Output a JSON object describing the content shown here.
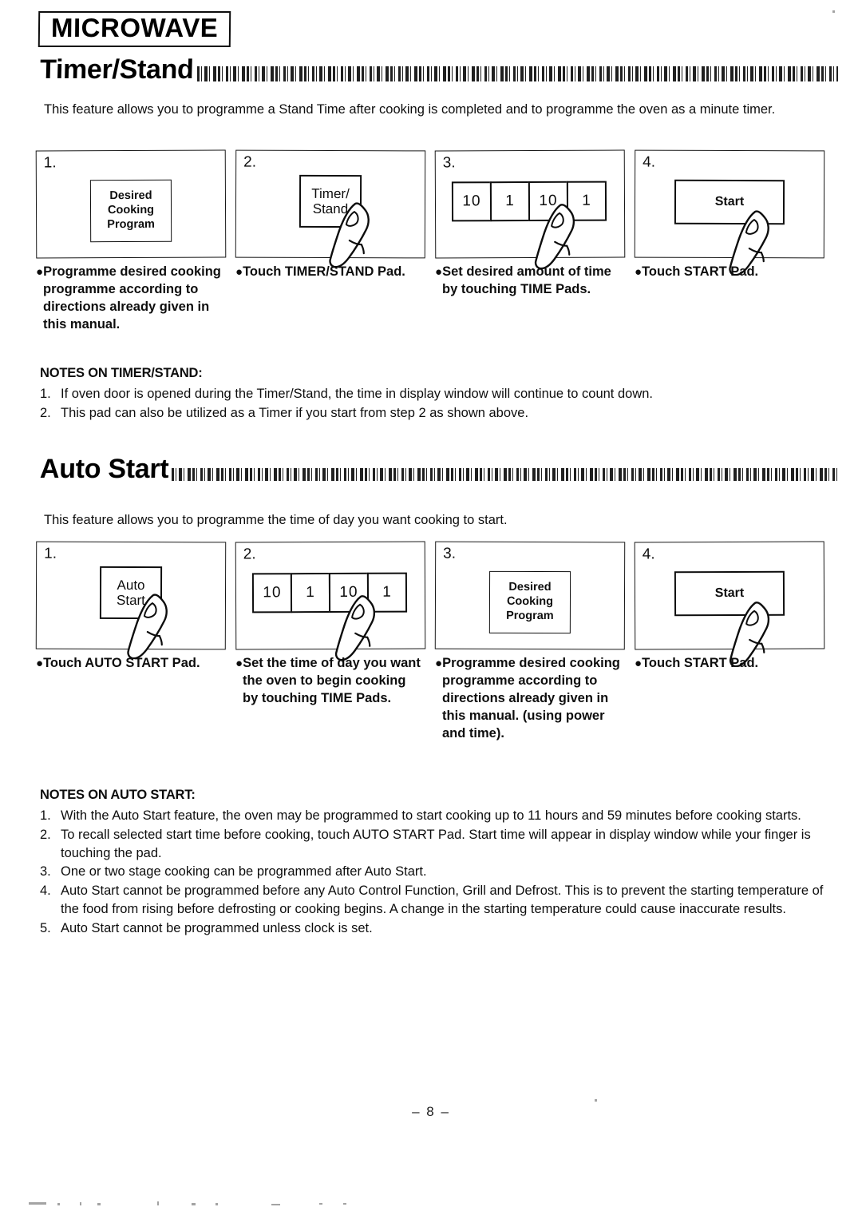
{
  "header": {
    "badge": "MICROWAVE"
  },
  "sections": [
    {
      "title": "Timer/Stand",
      "intro": "This feature allows you to programme a Stand Time after cooking is completed and to programme the oven as a minute timer.",
      "steps": [
        {
          "number": "1.",
          "pad_type": "program",
          "pad_lines": [
            "Desired",
            "Cooking",
            "Program"
          ],
          "finger": false,
          "caption": "Programme desired cooking programme according to directions already given in this manual."
        },
        {
          "number": "2.",
          "pad_type": "square",
          "pad_lines": [
            "Timer/",
            "Stand"
          ],
          "finger": true,
          "caption": "Touch TIMER/STAND Pad."
        },
        {
          "number": "3.",
          "pad_type": "keys",
          "keys": [
            "10",
            "1",
            "10",
            "1"
          ],
          "finger": true,
          "caption": "Set desired amount of time by touching TIME Pads."
        },
        {
          "number": "4.",
          "pad_type": "start",
          "pad_lines": [
            "Start"
          ],
          "finger": true,
          "caption": "Touch START Pad."
        }
      ],
      "notes_title": "NOTES ON TIMER/STAND:",
      "notes": [
        {
          "num": "1.",
          "text": "If oven door is opened during the Timer/Stand, the time in display window will continue to count down."
        },
        {
          "num": "2.",
          "text": "This pad can also be utilized as a Timer if you start from step 2 as shown above."
        }
      ]
    },
    {
      "title": "Auto Start",
      "intro": "This feature allows you to programme the time of day you want cooking to start.",
      "steps": [
        {
          "number": "1.",
          "pad_type": "square",
          "pad_lines": [
            "Auto",
            "Start"
          ],
          "finger": true,
          "caption": "Touch AUTO START Pad."
        },
        {
          "number": "2.",
          "pad_type": "keys",
          "keys": [
            "10",
            "1",
            "10",
            "1"
          ],
          "finger": true,
          "caption": "Set the time of day you want the oven to begin cooking by touching TIME Pads."
        },
        {
          "number": "3.",
          "pad_type": "program",
          "pad_lines": [
            "Desired",
            "Cooking",
            "Program"
          ],
          "finger": false,
          "caption": "Programme desired cooking programme according to directions already given in this manual. (using power and time)."
        },
        {
          "number": "4.",
          "pad_type": "start",
          "pad_lines": [
            "Start"
          ],
          "finger": true,
          "caption": "Touch START Pad."
        }
      ],
      "notes_title": "NOTES ON AUTO START:",
      "notes": [
        {
          "num": "1.",
          "text": "With the Auto Start feature, the oven may be programmed to start cooking up to 11 hours and 59 minutes before cooking starts."
        },
        {
          "num": "2.",
          "text": "To recall selected start time before cooking, touch AUTO START Pad. Start time will appear in display window while your finger is touching the pad."
        },
        {
          "num": "3.",
          "text": "One or two stage cooking can be programmed after Auto Start."
        },
        {
          "num": "4.",
          "text": "Auto Start cannot be programmed before any Auto Control Function, Grill and Defrost. This is to prevent the starting temperature of the food from rising before defrosting or cooking begins. A change in the starting temperature could cause inaccurate results."
        },
        {
          "num": "5.",
          "text": "Auto Start cannot be programmed unless clock is set."
        }
      ]
    }
  ],
  "footer": {
    "page_number": "– 8 –"
  }
}
